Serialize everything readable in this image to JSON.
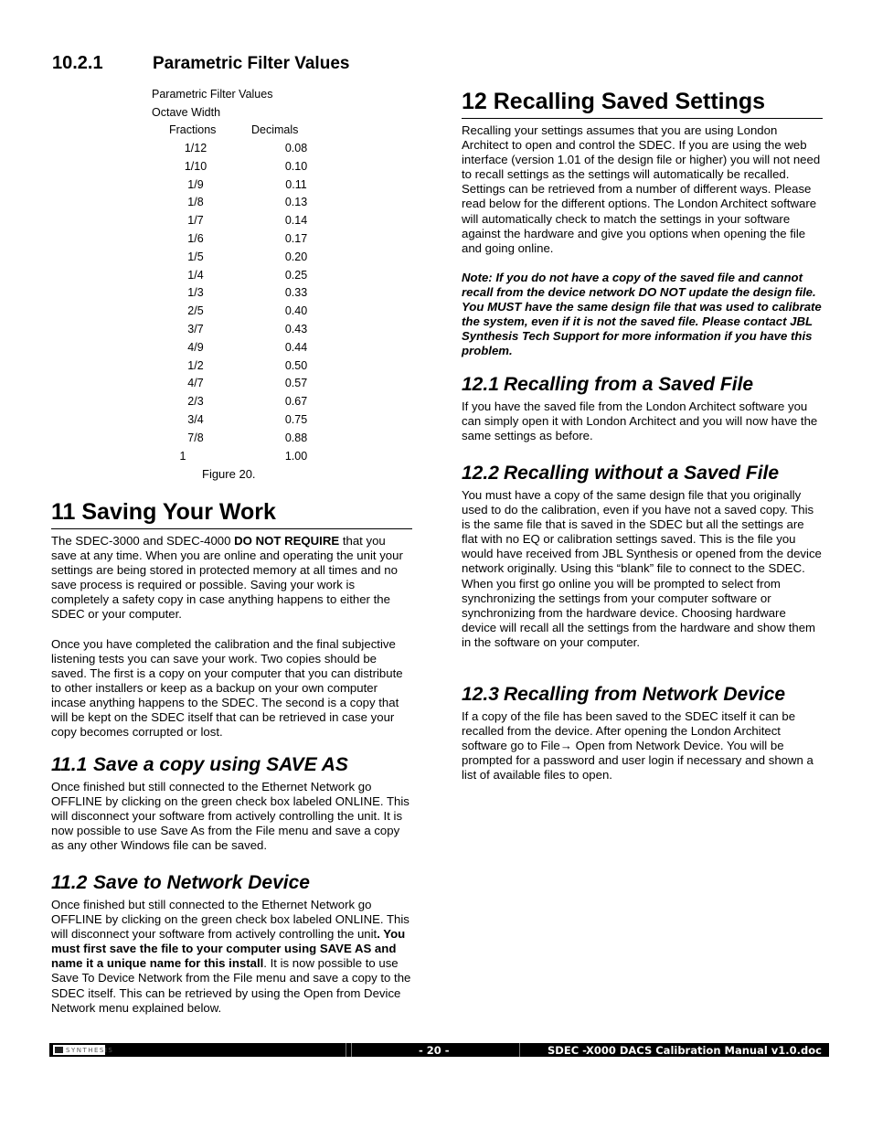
{
  "section_10_2_1": {
    "number": "10.2.1",
    "title": "Parametric Filter Values",
    "table": {
      "caption": "Parametric Filter Values",
      "subcaption": "Octave Width",
      "headers": [
        "Fractions",
        "Decimals"
      ],
      "rows": [
        [
          "1/12",
          "0.08"
        ],
        [
          "1/10",
          "0.10"
        ],
        [
          "1/9",
          "0.11"
        ],
        [
          "1/8",
          "0.13"
        ],
        [
          "1/7",
          "0.14"
        ],
        [
          "1/6",
          "0.17"
        ],
        [
          "1/5",
          "0.20"
        ],
        [
          "1/4",
          "0.25"
        ],
        [
          "1/3",
          "0.33"
        ],
        [
          "2/5",
          "0.40"
        ],
        [
          "3/7",
          "0.43"
        ],
        [
          "4/9",
          "0.44"
        ],
        [
          "1/2",
          "0.50"
        ],
        [
          "4/7",
          "0.57"
        ],
        [
          "2/3",
          "0.67"
        ],
        [
          "3/4",
          "0.75"
        ],
        [
          "7/8",
          "0.88"
        ],
        [
          "1",
          "1.00"
        ]
      ],
      "figure_label": "Figure 20."
    }
  },
  "section_11": {
    "title": "11 Saving Your Work",
    "p1_a": "The SDEC-3000 and SDEC-4000 ",
    "p1_bold": "DO NOT REQUIRE",
    "p1_b": " that you save at any time. When you are online and operating the unit your settings are being stored in protected memory at all times and no save process is required or possible. Saving your work is completely a safety copy in case anything happens to either the SDEC or your computer.",
    "p2": "Once you have completed the calibration and the final subjective listening tests you can save your work. Two copies should be saved. The first is a copy on your computer that you can distribute to other installers or keep as a backup on your own computer incase anything happens to the SDEC. The second is a copy that will be kept on the SDEC itself that can be retrieved in case your copy becomes corrupted or lost.",
    "sub1": {
      "number": "11.1",
      "title": "Save a copy using SAVE AS",
      "body": "Once finished but still connected to the Ethernet Network go OFFLINE by clicking on the green check box labeled ONLINE. This will disconnect your software from actively controlling the unit. It is now possible to use Save As from the File menu and save a copy as any other Windows file can be saved."
    },
    "sub2": {
      "number": "11.2",
      "title": "Save to Network Device",
      "body_a": "Once finished but still connected to the Ethernet Network go OFFLINE by clicking on the green check box labeled ONLINE. This will disconnect your software from actively controlling the unit",
      "body_bold": ". You must first save the file to your computer using SAVE AS and name it a unique name for this install",
      "body_b": ". It is now possible to use Save To Device Network from the File menu and save a copy to the SDEC itself. This can be retrieved by using the Open from Device Network menu explained below."
    }
  },
  "section_12": {
    "title": "12 Recalling Saved Settings",
    "intro": "Recalling your settings assumes that you are using London Architect to open and control the SDEC. If you are using the web interface (version 1.01 of the design file or higher) you will not need to recall settings as the settings will automatically be recalled. Settings can be retrieved from a number of different ways. Please read below for the different options. The London Architect software will automatically check to match the settings in your software against the hardware and give you options when opening the file and going online.",
    "note": "Note: If you do not have a copy of the saved file and cannot recall from the device network DO NOT update the design file. You MUST have the same design file that was used to calibrate the system, even if it is not the saved file. Please contact JBL Synthesis Tech Support for more information if you have this problem.",
    "sub1": {
      "number": "12.1",
      "title": "Recalling from a Saved File",
      "body": "If you have the saved file from the London Architect software you can simply open it with London Architect and you will now have the same settings as before."
    },
    "sub2": {
      "number": "12.2",
      "title": "Recalling without a Saved File",
      "body": "You must have a copy of the same design file that you originally used to do the calibration, even if you have not a saved copy. This is the same file that is saved in the SDEC but all the settings are flat with no EQ or calibration settings saved. This is the file you would have received from JBL Synthesis or opened from the device network originally. Using this “blank” file to connect to the SDEC. When you first go online you will be prompted to select from synchronizing the settings from your computer software or synchronizing from the hardware device. Choosing hardware device will recall all the settings from the hardware and show them in the software on your computer."
    },
    "sub3": {
      "number": "12.3",
      "title": "Recalling from Network Device",
      "body": "If a copy of the file has been saved to the SDEC itself it can be recalled from the device. After opening the London Architect software go to File→ Open from Network Device. You will be prompted for a password and user login if necessary and shown a list of available files to open."
    }
  },
  "footer": {
    "logo_text": "SYNTHESIS",
    "page": "- 20 -",
    "document": "SDEC -X000 DACS Calibration Manual v1.0.doc"
  }
}
